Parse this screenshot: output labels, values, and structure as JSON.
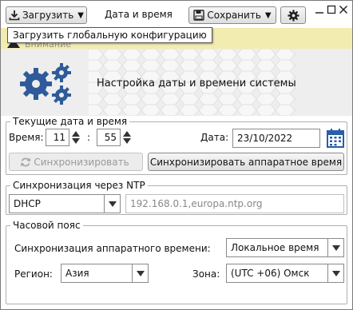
{
  "toolbar": {
    "load_label": "Загрузить",
    "title": "Дата и время",
    "save_label": "Сохранить"
  },
  "tooltip": "Загрузить глобальную конфигурацию",
  "banner": {
    "text": "Внимание"
  },
  "header": {
    "title": "Настройка даты и времени системы"
  },
  "current": {
    "legend": "Текущие дата и время",
    "time_label": "Время:",
    "hours": "11",
    "separator": ":",
    "minutes": "55",
    "date_label": "Дата:",
    "date_value": "23/10/2022",
    "sync_label": "Синхронизировать",
    "hw_sync_label": "Синхронизировать аппаратное время"
  },
  "ntp": {
    "legend": "Синхронизация через NTP",
    "mode": "DHCP",
    "servers_placeholder": "192.168.0.1,europa.ntp.org"
  },
  "timezone": {
    "legend": "Часовой пояс",
    "hw_sync_label": "Синхронизация аппаратного времени:",
    "hw_sync_value": "Локальное время",
    "region_label": "Регион:",
    "region_value": "Азия",
    "zone_label": "Зона:",
    "zone_value": "(UTC +06) Омск"
  },
  "colors": {
    "banner_bg": "#f2ecb0",
    "gear_blue": "#2f5b9a",
    "calendar_blue": "#2a5ea8"
  },
  "icons": [
    "download-icon",
    "save-icon",
    "gear-icon",
    "minimize-icon",
    "maximize-icon",
    "close-icon",
    "warning-icon",
    "gears-icon",
    "calendar-icon",
    "refresh-icon"
  ]
}
